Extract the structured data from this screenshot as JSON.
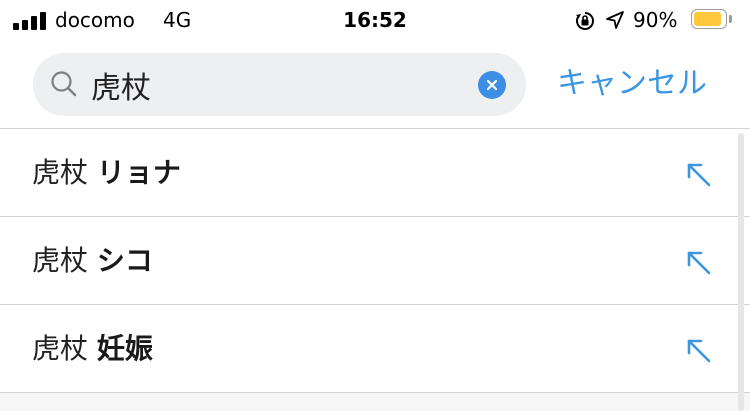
{
  "status_bar": {
    "carrier": "docomo",
    "network": "4G",
    "time": "16:52",
    "battery_percent": "90%",
    "battery_level": 0.9,
    "battery_color": "#ffc83d"
  },
  "search": {
    "query": "虎杖",
    "placeholder": "",
    "cancel_label": "キャンセル"
  },
  "suggestions": [
    {
      "prefix": "虎杖",
      "suffix": "リョナ"
    },
    {
      "prefix": "虎杖",
      "suffix": "シコ"
    },
    {
      "prefix": "虎杖",
      "suffix": "妊娠"
    }
  ],
  "colors": {
    "accent": "#3b96e2",
    "search_bg": "#eeeff1",
    "divider": "#d4d4d4"
  }
}
